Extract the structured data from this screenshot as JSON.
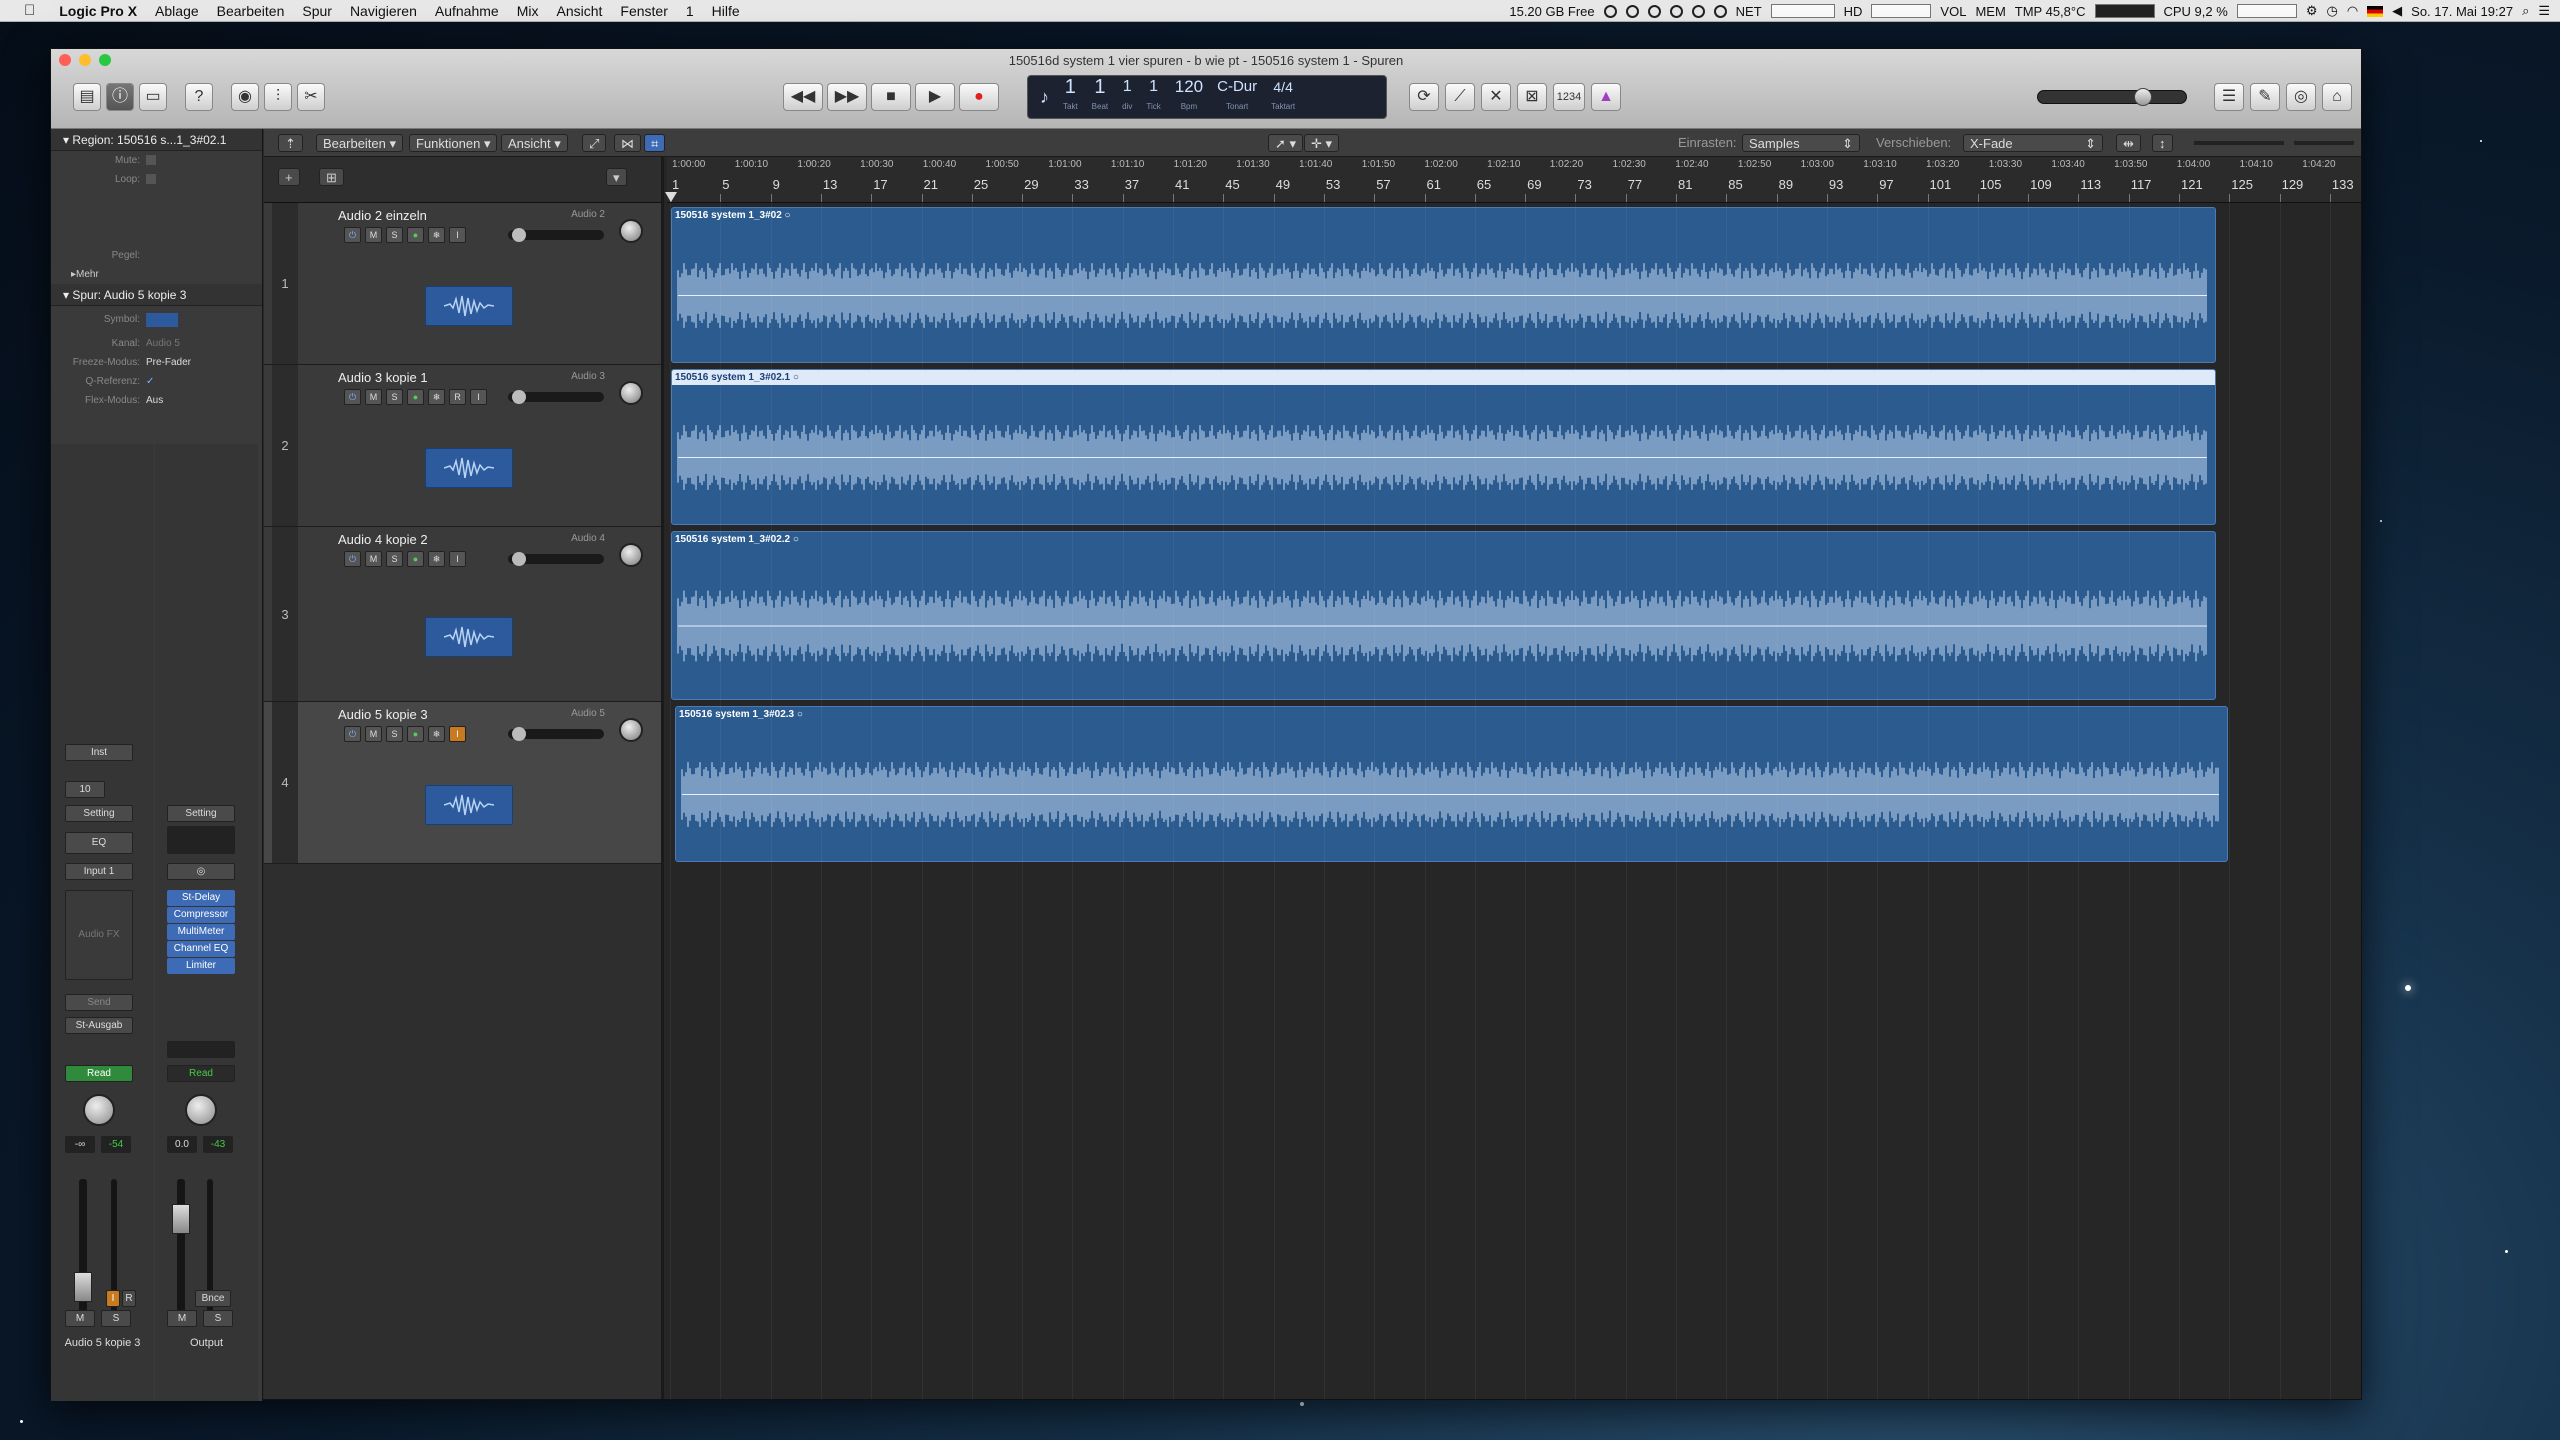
{
  "menubar": {
    "apple": "",
    "app": "Logic Pro X",
    "items": [
      "Ablage",
      "Bearbeiten",
      "Spur",
      "Navigieren",
      "Aufnahme",
      "Mix",
      "Ansicht",
      "Fenster",
      "1",
      "Hilfe"
    ],
    "free": "15.20 GB Free",
    "net": "NET",
    "hd": "HD",
    "vol": "VOL",
    "mem": "MEM",
    "tmp": "TMP 45,8°C",
    "cpu": "CPU 9,2 %",
    "date": "So. 17. Mai 19:27"
  },
  "window": {
    "title": "150516d system 1 vier spuren - b wie pt - 150516 system 1 - Spuren"
  },
  "lcd": {
    "bar": "1",
    "bar_label": "Takt",
    "beat": "1",
    "beat_label": "Beat",
    "div": "1",
    "div_label": "div",
    "tick": "1",
    "tick_label": "Tick",
    "tempo": "120",
    "tempo_label": "Bpm",
    "key": "C-Dur",
    "key_label": "Tonart",
    "sig": "4/4",
    "sig_label": "Taktart"
  },
  "toolbar": {
    "counter": "1234"
  },
  "inspector": {
    "region_header": "Region: 150516 s...1_3#02.1",
    "mute": "Mute:",
    "loop": "Loop:",
    "pegel": "Pegel:",
    "mehr": "Mehr",
    "track_header": "Spur: Audio 5 kopie 3",
    "symbol": "Symbol:",
    "kanal_k": "Kanal:",
    "kanal_v": "Audio 5",
    "freeze_k": "Freeze-Modus:",
    "freeze_v": "Pre-Fader",
    "q_k": "Q-Referenz:",
    "q_v": "✓",
    "flex_k": "Flex-Modus:",
    "flex_v": "Aus",
    "strip1": {
      "inst": "Inst",
      "num": "10",
      "setting": "Setting",
      "eq": "EQ",
      "input": "Input 1",
      "audiofx": "Audio FX",
      "send": "Send",
      "out": "St-Ausgab",
      "auto": "Read",
      "val1": "-∞",
      "val2": "-54",
      "m": "M",
      "s": "S",
      "i": "I",
      "r": "R",
      "name": "Audio 5 kopie 3"
    },
    "strip2": {
      "setting": "Setting",
      "plugins": [
        "St-Delay",
        "Compressor",
        "MultiMeter",
        "Channel EQ",
        "Limiter"
      ],
      "auto": "Read",
      "val1": "0.0",
      "val2": "-43",
      "bnce": "Bnce",
      "m": "M",
      "s": "S",
      "name": "Output"
    }
  },
  "tracksbar": {
    "bearbeiten": "Bearbeiten",
    "funktionen": "Funktionen",
    "ansicht": "Ansicht",
    "einrasten_label": "Einrasten:",
    "einrasten_value": "Samples",
    "verschieben_label": "Verschieben:",
    "verschieben_value": "X-Fade"
  },
  "ruler": {
    "times": [
      "1:00:00",
      "1:00:10",
      "1:00:20",
      "1:00:30",
      "1:00:40",
      "1:00:50",
      "1:01:00",
      "1:01:10",
      "1:01:20",
      "1:01:30",
      "1:01:40",
      "1:01:50",
      "1:02:00",
      "1:02:10",
      "1:02:20",
      "1:02:30",
      "1:02:40",
      "1:02:50",
      "1:03:00",
      "1:03:10",
      "1:03:20",
      "1:03:30",
      "1:03:40",
      "1:03:50",
      "1:04:00",
      "1:04:10",
      "1:04:20"
    ],
    "bars": [
      "1",
      "5",
      "9",
      "13",
      "17",
      "21",
      "25",
      "29",
      "33",
      "37",
      "41",
      "45",
      "49",
      "53",
      "57",
      "61",
      "65",
      "69",
      "73",
      "77",
      "81",
      "85",
      "89",
      "93",
      "97",
      "101",
      "105",
      "109",
      "113",
      "117",
      "121",
      "125",
      "129",
      "133"
    ]
  },
  "tracks": [
    {
      "num": "1",
      "name": "Audio 2 einzeln",
      "channel": "Audio 2",
      "region": "150516 system 1_3#02",
      "selected": false
    },
    {
      "num": "2",
      "name": "Audio 3 kopie 1",
      "channel": "Audio 3",
      "region": "150516 system 1_3#02.1",
      "selected": true
    },
    {
      "num": "3",
      "name": "Audio 4 kopie 2",
      "channel": "Audio 4",
      "region": "150516 system 1_3#02.2",
      "selected": false
    },
    {
      "num": "4",
      "name": "Audio 5 kopie 3",
      "channel": "Audio 5",
      "region": "150516 system 1_3#02.3",
      "selected": false
    }
  ],
  "track_buttons": {
    "power": "⏻",
    "m": "M",
    "s": "S",
    "r": "R",
    "i": "I"
  },
  "colors": {
    "region": "#2c5b8f",
    "waveform": "#c9ddf5",
    "accent": "#3d6bb6"
  }
}
